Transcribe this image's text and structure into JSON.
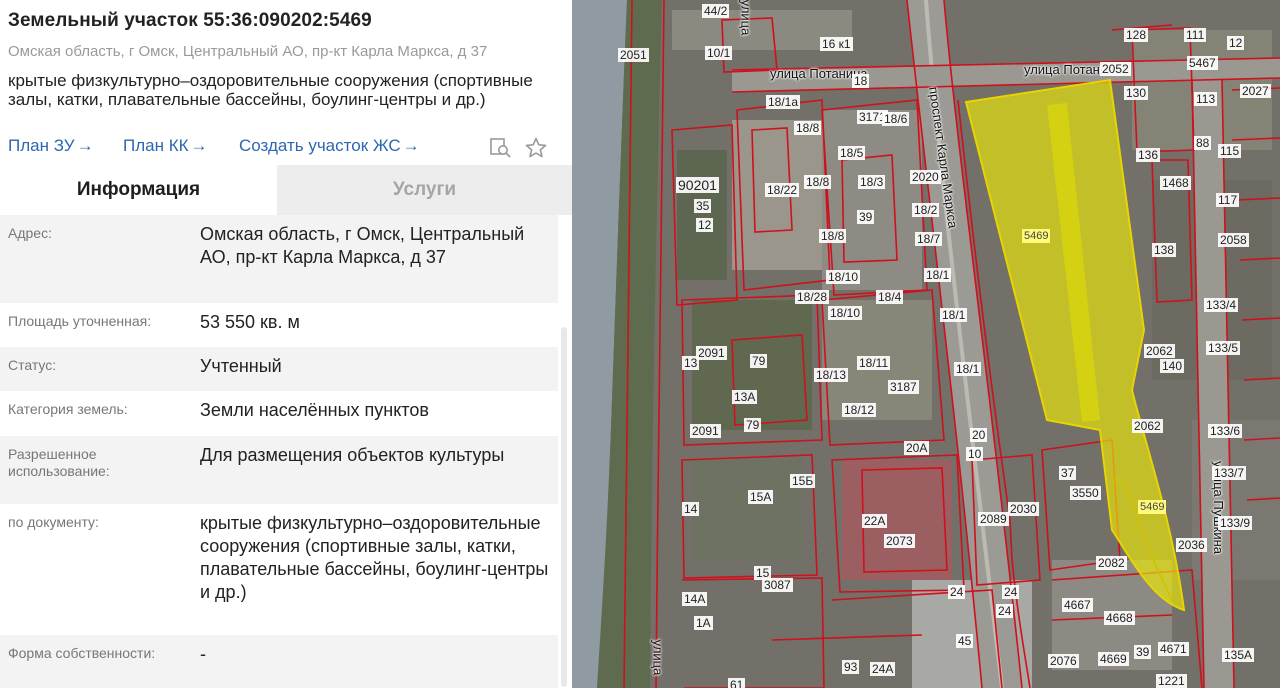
{
  "parcel": {
    "title": "Земельный участок 55:36:090202:5469",
    "address": "Омская область, г Омск, Центральный АО, пр-кт Карла Маркса, д 37",
    "purpose": "крытые физкультурно–оздоровительные сооружения (спортивные залы, катки, плавательные бассейны, боулинг-центры и др.)"
  },
  "links": {
    "plan_zu": "План ЗУ",
    "plan_kk": "План КК",
    "create_zhs": "Создать участок ЖС",
    "arrow": "→"
  },
  "tabs": {
    "info": "Информация",
    "services": "Услуги"
  },
  "info_rows": {
    "address": {
      "label": "Адрес:",
      "value": "Омская область, г Омск, Центральный АО, пр-кт Карла Маркса, д 37"
    },
    "area": {
      "label": "Площадь уточненная:",
      "value": "53 550 кв. м"
    },
    "status": {
      "label": "Статус:",
      "value": "Учтенный"
    },
    "category": {
      "label": "Категория земель:",
      "value": "Земли населённых пунктов"
    },
    "permitted": {
      "label": "Разрешенное использование:",
      "value": "Для размещения объектов культуры"
    },
    "by_document": {
      "label": "по документу:",
      "value": "крытые физкультурно–оздоровительные сооружения (спортивные залы, катки, плавательные бассейны, боулинг-центры и др.)"
    },
    "ownership": {
      "label": "Форма собственности:",
      "value": "-"
    }
  },
  "map": {
    "highlight_color": "#f4f000",
    "border_color": "#d0101c",
    "streets": {
      "potanina_left": "улица Потанина",
      "potanina_right": "улица Потанина",
      "prospekt": "проспект Карла Маркса",
      "pushkina": "улица Пушкина",
      "ulitsa_top": "улица",
      "ulitsa_bottom": "улица"
    },
    "labels": {
      "l44_2": "44/2",
      "l2051": "2051",
      "l10_1": "10/1",
      "l16k1": "16 к1",
      "l18": "18",
      "l18_1a": "18/1а",
      "l18_8a": "18/8",
      "l3171": "3171",
      "l18_6": "18/6",
      "l18_5": "18/5",
      "l18_22": "18/22",
      "l18_8b": "18/8",
      "l18_3": "18/3",
      "l2020": "2020",
      "l18_2": "18/2",
      "l18_7": "18/7",
      "l18_8c": "18/8",
      "l39": "39",
      "l90201": "90201",
      "l35": "35",
      "l12": "12",
      "l18_10a": "18/10",
      "l18_28": "18/28",
      "l18_4": "18/4",
      "l18_1b": "18/1",
      "l18_1c": "18/1",
      "l18_10b": "18/10",
      "l2091a": "2091",
      "l13": "13",
      "l79a": "79",
      "l13a": "13А",
      "l18_13": "18/13",
      "l18_11": "18/11",
      "l3187": "3187",
      "l18_1d": "18/1",
      "l18_12": "18/12",
      "l2091b": "2091",
      "l79b": "79",
      "l20a": "20А",
      "l20": "20",
      "l10": "10",
      "l15a": "15А",
      "l15b": "15Б",
      "l14": "14",
      "l22a": "22А",
      "l2073": "2073",
      "l2089": "2089",
      "l2030": "2030",
      "l15": "15",
      "l3087": "3087",
      "l14a": "14А",
      "l1a": "1А",
      "l24a": "24",
      "l24b": "24",
      "l24c": "24",
      "l45": "45",
      "l93": "93",
      "l24a2": "24А",
      "l61": "61",
      "l128": "128",
      "l111": "111",
      "l12b": "12",
      "l5467": "5467",
      "l2027": "2027",
      "l130": "130",
      "l113": "113",
      "l88": "88",
      "l136": "136",
      "l115": "115",
      "l117": "117",
      "l138": "138",
      "l2058": "2058",
      "l133_4": "133/4",
      "l133_5": "133/5",
      "l140": "140",
      "l2062a": "2062",
      "l2062b": "2062",
      "l133_6": "133/6",
      "l133_7": "133/7",
      "l133_9": "133/9",
      "l37": "37",
      "l3550": "3550",
      "l2082": "2082",
      "l2036": "2036",
      "l4667": "4667",
      "l4668": "4668",
      "l4669": "4669",
      "l39b": "39",
      "l4671": "4671",
      "l135a": "135А",
      "l2076": "2076",
      "l1221": "1221",
      "l5469a": "5469",
      "l5469b": "5469",
      "l2052": "2052",
      "l1468": "1468"
    }
  }
}
